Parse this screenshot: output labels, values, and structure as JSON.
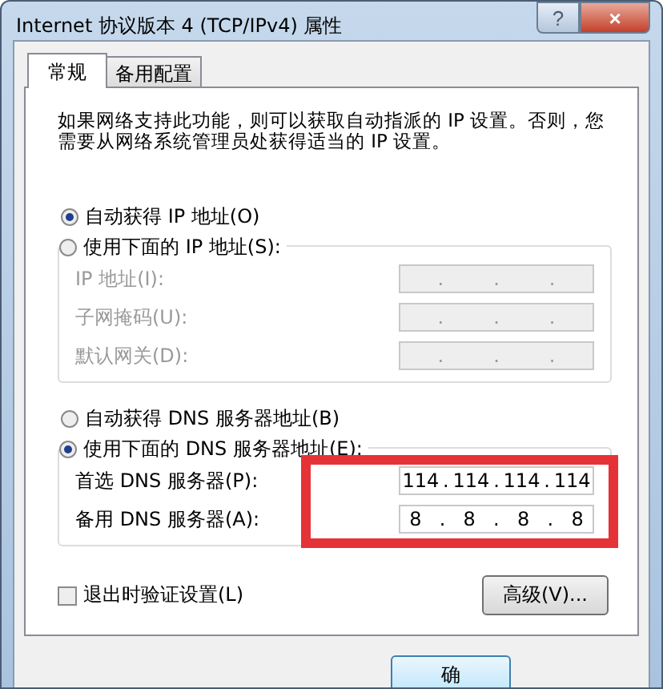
{
  "window": {
    "title": "Internet 协议版本 4 (TCP/IPv4) 属性",
    "help": "?",
    "close": "×"
  },
  "tabs": [
    {
      "label": "常规",
      "selected": true
    },
    {
      "label": "备用配置",
      "selected": false
    }
  ],
  "description": "如果网络支持此功能，则可以获取自动指派的 IP 设置。否则，您需要从网络系统管理员处获得适当的 IP 设置。",
  "ip_mode": [
    {
      "label": "自动获得 IP 地址(O)",
      "selected": true
    },
    {
      "label": "使用下面的 IP 地址(S):",
      "selected": false
    }
  ],
  "ip_fields": [
    {
      "label": "IP 地址(I):",
      "disabled": true
    },
    {
      "label": "子网掩码(U):",
      "disabled": true
    },
    {
      "label": "默认网关(D):",
      "disabled": true
    }
  ],
  "dns_mode": [
    {
      "label": "自动获得 DNS 服务器地址(B)",
      "selected": false
    },
    {
      "label": "使用下面的 DNS 服务器地址(E):",
      "selected": true
    }
  ],
  "dns_fields": [
    {
      "label": "首选 DNS 服务器(P):",
      "disabled": false,
      "octets": [
        "114",
        "114",
        "114",
        "114"
      ]
    },
    {
      "label": "备用 DNS 服务器(A):",
      "disabled": false,
      "octets": [
        "8",
        "8",
        "8",
        "8"
      ]
    }
  ],
  "separator": ".",
  "highlight": {
    "shown": true,
    "color": "#e53237"
  },
  "validate": {
    "label": "退出时验证设置(L)",
    "checked": false
  },
  "advanced_button": "高级(V)...",
  "buttons": [
    "确"
  ]
}
